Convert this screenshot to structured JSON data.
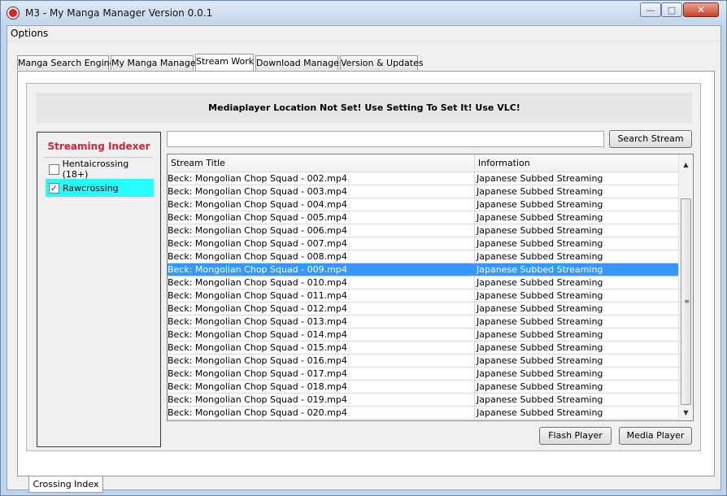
{
  "window": {
    "title": "M3 - My Manga Manager Version 0.0.1",
    "min_glyph": "—",
    "max_glyph": "□",
    "close_glyph": "✕"
  },
  "menu": {
    "options": "Options"
  },
  "tabs": [
    {
      "label": "Manga Search Engine",
      "active": false
    },
    {
      "label": "My Manga Manager",
      "active": false
    },
    {
      "label": "Stream Work",
      "active": true
    },
    {
      "label": "Download Manager",
      "active": false
    },
    {
      "label": "Version & Updates",
      "active": false
    }
  ],
  "notice": "Mediaplayer Location Not Set! Use Setting To Set It! Use VLC!",
  "indexer": {
    "title": "Streaming Indexer",
    "title_color": "#d3233a",
    "items": [
      {
        "label": "Hentaicrossing (18+)",
        "checked": false,
        "selected": false
      },
      {
        "label": "Rawcrossing",
        "checked": true,
        "selected": true
      }
    ],
    "selected_color": "#26ffff"
  },
  "search": {
    "value": "",
    "button": "Search Stream"
  },
  "table": {
    "columns": [
      "Stream Title",
      "Information"
    ],
    "selected_color": "#3399ff",
    "rows": [
      {
        "title": "Beck: Mongolian Chop Squad - 002.mp4",
        "info": "Japanese Subbed Streaming",
        "selected": false
      },
      {
        "title": "Beck: Mongolian Chop Squad - 003.mp4",
        "info": "Japanese Subbed Streaming",
        "selected": false
      },
      {
        "title": "Beck: Mongolian Chop Squad - 004.mp4",
        "info": "Japanese Subbed Streaming",
        "selected": false
      },
      {
        "title": "Beck: Mongolian Chop Squad - 005.mp4",
        "info": "Japanese Subbed Streaming",
        "selected": false
      },
      {
        "title": "Beck: Mongolian Chop Squad - 006.mp4",
        "info": "Japanese Subbed Streaming",
        "selected": false
      },
      {
        "title": "Beck: Mongolian Chop Squad - 007.mp4",
        "info": "Japanese Subbed Streaming",
        "selected": false
      },
      {
        "title": "Beck: Mongolian Chop Squad - 008.mp4",
        "info": "Japanese Subbed Streaming",
        "selected": false
      },
      {
        "title": "Beck: Mongolian Chop Squad - 009.mp4",
        "info": "Japanese Subbed Streaming",
        "selected": true
      },
      {
        "title": "Beck: Mongolian Chop Squad - 010.mp4",
        "info": "Japanese Subbed Streaming",
        "selected": false
      },
      {
        "title": "Beck: Mongolian Chop Squad - 011.mp4",
        "info": "Japanese Subbed Streaming",
        "selected": false
      },
      {
        "title": "Beck: Mongolian Chop Squad - 012.mp4",
        "info": "Japanese Subbed Streaming",
        "selected": false
      },
      {
        "title": "Beck: Mongolian Chop Squad - 013.mp4",
        "info": "Japanese Subbed Streaming",
        "selected": false
      },
      {
        "title": "Beck: Mongolian Chop Squad - 014.mp4",
        "info": "Japanese Subbed Streaming",
        "selected": false
      },
      {
        "title": "Beck: Mongolian Chop Squad - 015.mp4",
        "info": "Japanese Subbed Streaming",
        "selected": false
      },
      {
        "title": "Beck: Mongolian Chop Squad - 016.mp4",
        "info": "Japanese Subbed Streaming",
        "selected": false
      },
      {
        "title": "Beck: Mongolian Chop Squad - 017.mp4",
        "info": "Japanese Subbed Streaming",
        "selected": false
      },
      {
        "title": "Beck: Mongolian Chop Squad - 018.mp4",
        "info": "Japanese Subbed Streaming",
        "selected": false
      },
      {
        "title": "Beck: Mongolian Chop Squad - 019.mp4",
        "info": "Japanese Subbed Streaming",
        "selected": false
      },
      {
        "title": "Beck: Mongolian Chop Squad - 020.mp4",
        "info": "Japanese Subbed Streaming",
        "selected": false
      }
    ]
  },
  "scrollbar": {
    "up_glyph": "▲",
    "down_glyph": "▼",
    "grip_glyph": "≡"
  },
  "buttons": {
    "flash": "Flash Player",
    "media": "Media Player"
  },
  "bottom_tab": "Crossing Index"
}
